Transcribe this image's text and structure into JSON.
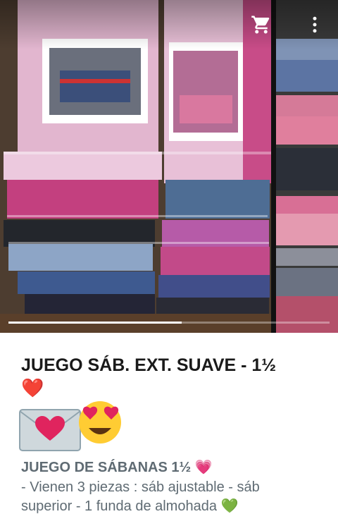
{
  "gallery": {
    "image_count_progress": 0.54,
    "cart_icon": "shopping-cart-icon",
    "menu_icon": "more-vertical-icon"
  },
  "product": {
    "title": "JUEGO SÁB. EXT. SUAVE - 1½",
    "title_emoji": "❤️",
    "subtitle": "JUEGO DE SÁBANAS 1½",
    "subtitle_emoji": "💗",
    "description_line1": "- Vienen 3 piezas : sáb ajustable - sáb",
    "description_line2": "superior - 1 funda de almohada",
    "description_emoji": "💚"
  },
  "colors": {
    "title": "#1a1a1a",
    "body_text": "#5f6b73",
    "heart_red": "#e0245e",
    "heart_green": "#4caf50",
    "heart_pink": "#f06292"
  }
}
